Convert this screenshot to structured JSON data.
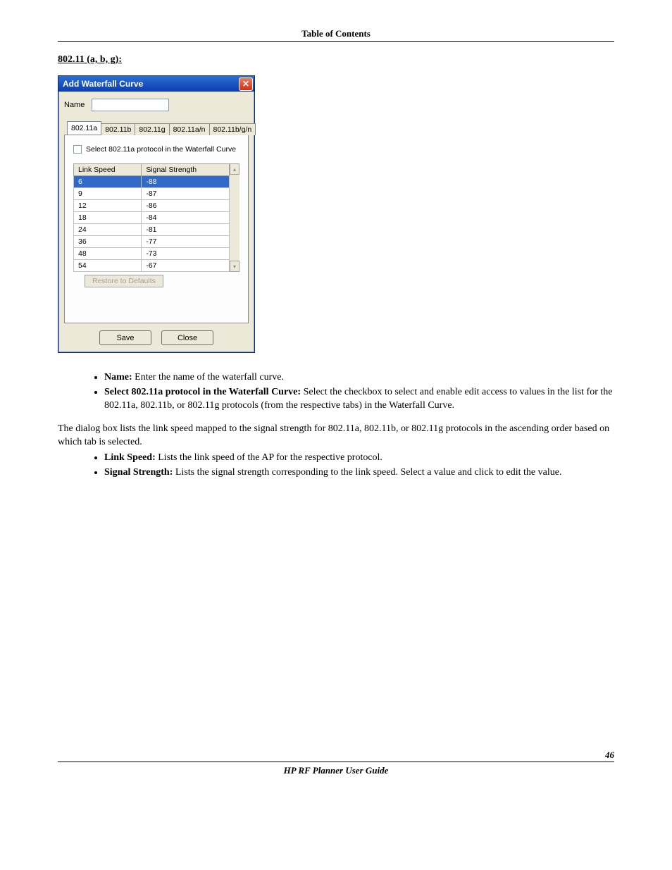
{
  "header": {
    "toc": "Table of Contents"
  },
  "section": {
    "title": "802.11 (a, b, g):"
  },
  "dialog": {
    "title": "Add Waterfall Curve",
    "close_x": "✕",
    "name_label": "Name",
    "name_value": "",
    "tabs": [
      "802.11a",
      "802.11b",
      "802.11g",
      "802.11a/n",
      "802.11b/g/n"
    ],
    "checkbox_label": "Select 802.11a protocol in the Waterfall Curve",
    "grid": {
      "cols": [
        "Link Speed",
        "Signal Strength"
      ],
      "rows": [
        {
          "speed": "6",
          "signal": "-88"
        },
        {
          "speed": "9",
          "signal": "-87"
        },
        {
          "speed": "12",
          "signal": "-86"
        },
        {
          "speed": "18",
          "signal": "-84"
        },
        {
          "speed": "24",
          "signal": "-81"
        },
        {
          "speed": "36",
          "signal": "-77"
        },
        {
          "speed": "48",
          "signal": "-73"
        },
        {
          "speed": "54",
          "signal": "-67"
        }
      ]
    },
    "restore": "Restore to Defaults",
    "save": "Save",
    "close": "Close"
  },
  "body": {
    "bullet1_label": "Name:",
    "bullet1_text": " Enter the name of the waterfall curve.",
    "bullet2_label": "Select 802.11a protocol in the Waterfall Curve:",
    "bullet2_text": " Select the checkbox to select and enable edit access to values in the list for the 802.11a, 802.11b, or 802.11g protocols (from the respective tabs) in the Waterfall Curve.",
    "para": "The dialog box lists the link speed mapped to the signal strength for 802.11a, 802.11b, or 802.11g protocols in the ascending order based on which tab is selected.",
    "bullet3_label": "Link Speed:",
    "bullet3_text": " Lists the link speed of the AP for the respective protocol.",
    "bullet4_label": "Signal Strength:",
    "bullet4_text": " Lists the signal strength corresponding to the link speed. Select a value and click to edit the value."
  },
  "footer": {
    "page": "46",
    "title": "HP RF Planner User Guide"
  }
}
